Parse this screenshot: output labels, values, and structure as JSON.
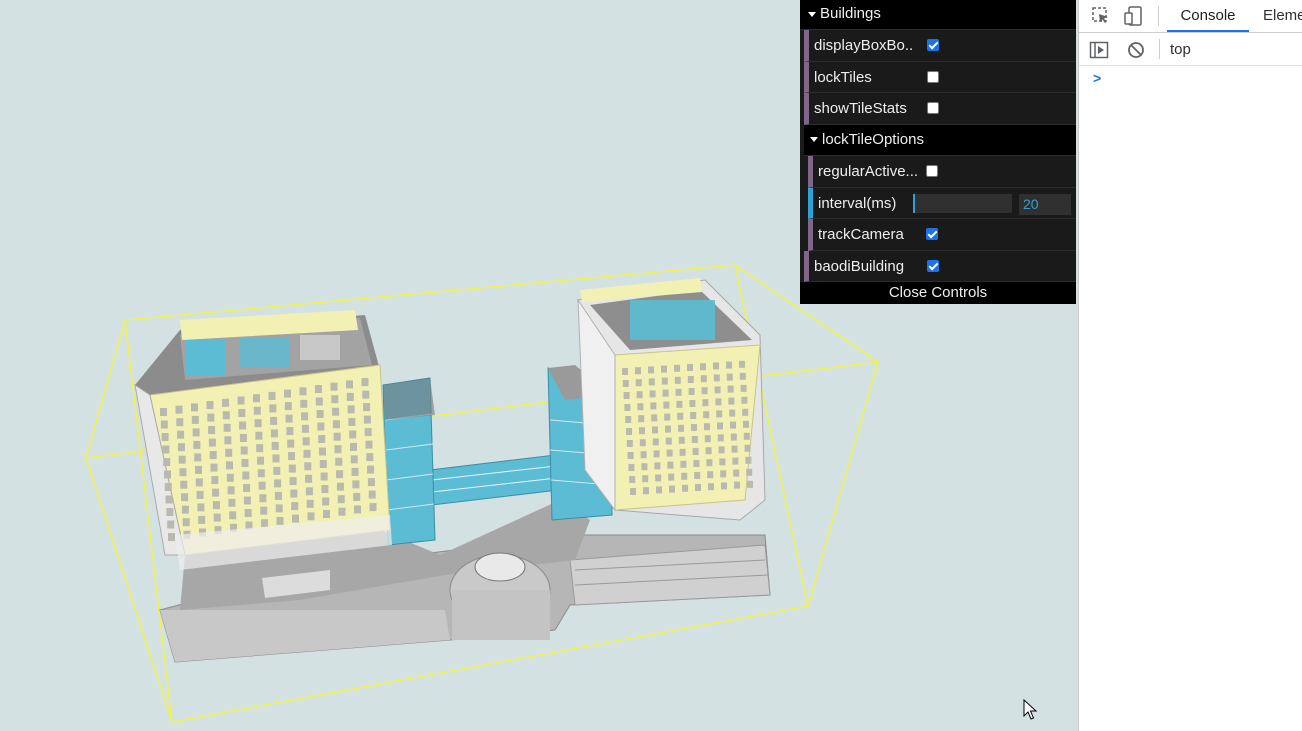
{
  "gui": {
    "buildings_folder": "Buildings",
    "rows": [
      {
        "label": "displayBoxBo...",
        "checked": true
      },
      {
        "label": "lockTiles",
        "checked": false
      },
      {
        "label": "showTileStats",
        "checked": false
      }
    ],
    "lock_folder": "lockTileOptions",
    "lock_rows": {
      "regular": {
        "label": "regularActive...",
        "checked": false
      },
      "interval": {
        "label": "interval(ms)",
        "value": "20"
      },
      "track": {
        "label": "trackCamera",
        "checked": true
      }
    },
    "baodi": {
      "label": "baodiBuilding",
      "checked": true
    },
    "close_label": "Close Controls"
  },
  "devtools": {
    "tabs": [
      "Console",
      "Eleme"
    ],
    "context": "top",
    "prompt": ">"
  },
  "colors": {
    "scene_bg": "#d3e1e3",
    "bounding_box": "#f2f24a",
    "glass": "#5bbcd4",
    "facade": "#f3f0b4",
    "concrete": "#a9a9a9"
  }
}
